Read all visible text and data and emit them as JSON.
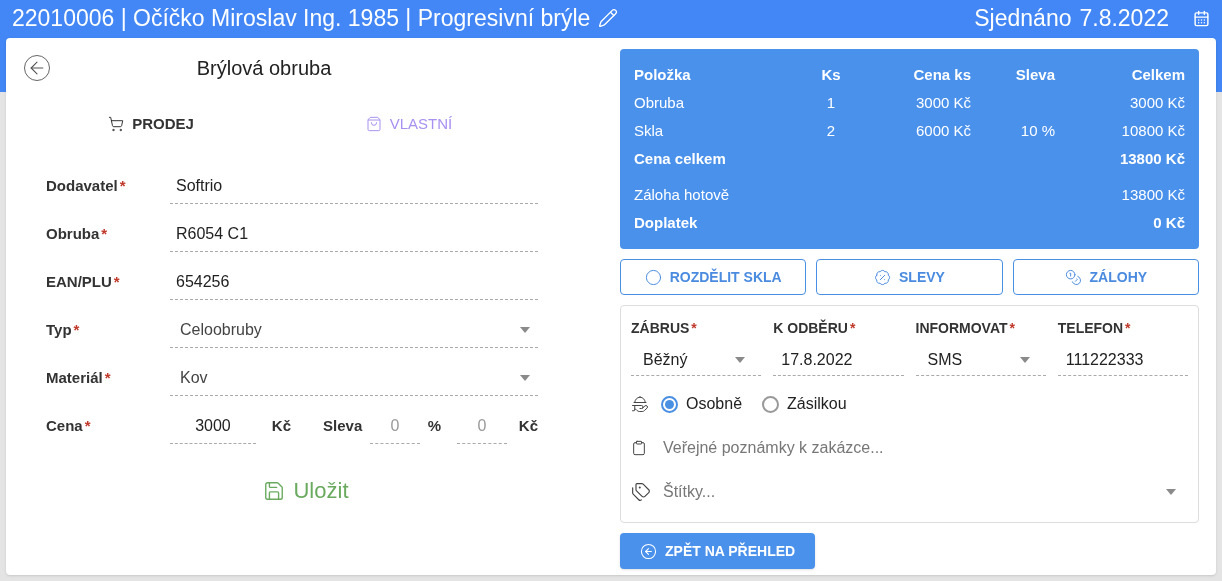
{
  "header": {
    "title": "22010006 | Očíčko Miroslav Ing. 1985 | Progresivní brýle",
    "status": "Sjednáno",
    "date": "7.8.2022"
  },
  "frame_panel": {
    "title": "Brýlová obruba",
    "mode_tabs": [
      {
        "label": "PRODEJ",
        "selected": true
      },
      {
        "label": "VLASTNÍ",
        "selected": false
      }
    ],
    "fields": [
      {
        "label": "Dodavatel",
        "required_mark": "*",
        "kind": "text",
        "value": "Softrio"
      },
      {
        "label": "Obruba",
        "required_mark": "*",
        "kind": "text",
        "value": "R6054 C1"
      },
      {
        "label": "EAN/PLU",
        "required_mark": "*",
        "kind": "text",
        "value": "654256"
      },
      {
        "label": "Typ",
        "required_mark": "*",
        "kind": "select",
        "value": "Celoobruby"
      },
      {
        "label": "Materiál",
        "required_mark": "*",
        "kind": "select",
        "value": "Kov"
      }
    ],
    "price": {
      "label": "Cena",
      "required_mark": "*",
      "value": "3000",
      "unit": "Kč",
      "discount_label": "Sleva",
      "discount_percent": "0",
      "percent_unit": "%",
      "discount_amount": "0",
      "amount_unit": "Kč"
    },
    "save_button": "Uložit"
  },
  "summary": {
    "columns": [
      "Položka",
      "Ks",
      "Cena ks",
      "Sleva",
      "Celkem"
    ],
    "rows": [
      {
        "item": "Obruba",
        "qty": "1",
        "unit_price": "3000 Kč",
        "total": "3000 Kč"
      },
      {
        "item": "Skla",
        "qty": "2",
        "unit_price": "6000 Kč",
        "discount": "10 %",
        "total": "10800 Kč"
      }
    ],
    "total": {
      "label": "Cena celkem",
      "value": "13800 Kč"
    },
    "payments": [
      {
        "label": "Záloha hotově",
        "value": "13800 Kč",
        "bold": false
      },
      {
        "label": "Doplatek",
        "value": "0 Kč",
        "bold": true
      }
    ]
  },
  "action_buttons": [
    "ROZDĚLIT SKLA",
    "SLEVY",
    "ZÁLOHY"
  ],
  "order": {
    "fields": [
      {
        "label": "ZÁBRUS",
        "required_mark": "*",
        "kind": "select",
        "value": "Běžný"
      },
      {
        "label": "K ODBĚRU",
        "required_mark": "*",
        "kind": "text",
        "value": "17.8.2022"
      },
      {
        "label": "INFORMOVAT",
        "required_mark": "*",
        "kind": "select",
        "value": "SMS"
      },
      {
        "label": "TELEFON",
        "required_mark": "*",
        "kind": "text",
        "value": "111222333"
      }
    ],
    "delivery": [
      {
        "label": "Osobně",
        "selected": true
      },
      {
        "label": "Zásilkou",
        "selected": false
      }
    ],
    "notes_placeholder": "Veřejné poznámky k zakázce...",
    "tags_placeholder": "Štítky..."
  },
  "back_button": "ZPĚT NA PŘEHLED"
}
